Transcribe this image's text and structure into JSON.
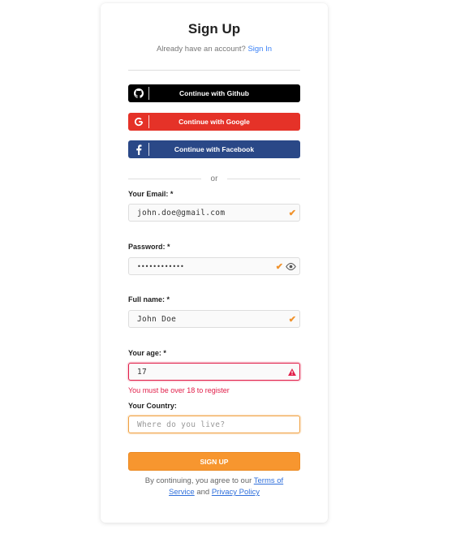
{
  "header": {
    "title": "Sign Up",
    "subtitle": "Already have an account?",
    "signin_link": "Sign In"
  },
  "social": {
    "github": {
      "label": "Continue with Github",
      "icon": "github-icon",
      "color": "#000000"
    },
    "google": {
      "label": "Continue with Google",
      "icon": "google-icon",
      "color": "#e53228"
    },
    "facebook": {
      "label": "Continue with Facebook",
      "icon": "facebook-icon",
      "color": "#2a4887"
    }
  },
  "divider": {
    "or": "or"
  },
  "form": {
    "email": {
      "label": "Your Email: *",
      "value": "john.doe@gmail.com",
      "status": "valid"
    },
    "password": {
      "label": "Password: *",
      "value": "••••••••••••",
      "status": "valid"
    },
    "fullname": {
      "label": "Full name: *",
      "value": "John Doe",
      "status": "valid"
    },
    "age": {
      "label": "Your age: *",
      "value": "17",
      "status": "error",
      "error": "You must be over 18 to register"
    },
    "country": {
      "label": "Your Country:",
      "value": "",
      "placeholder": "Where do you live?",
      "status": "focused"
    }
  },
  "submit": {
    "label": "SIGN UP",
    "color": "#f7962f"
  },
  "terms": {
    "prefix": "By continuing, you agree to our",
    "terms_link": "Terms of Service",
    "and": "and",
    "privacy_link": "Privacy Policy"
  },
  "colors": {
    "accent": "#f7962f",
    "error": "#e11d48",
    "link": "#3b82f6"
  }
}
